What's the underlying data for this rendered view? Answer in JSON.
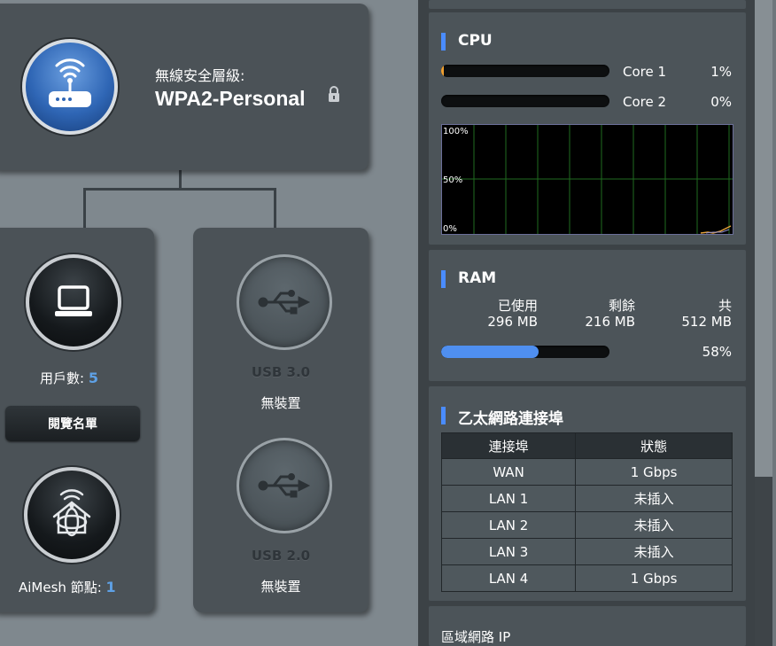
{
  "router": {
    "security_label": "無線安全層級:",
    "security_value": "WPA2-Personal"
  },
  "clients": {
    "label": "用戶數:",
    "count": "5",
    "view_list_label": "閱覽名單"
  },
  "aimesh": {
    "label": "AiMesh 節點:",
    "count": "1"
  },
  "usb": [
    {
      "title": "USB 3.0",
      "status": "無裝置"
    },
    {
      "title": "USB 2.0",
      "status": "無裝置"
    }
  ],
  "cpu": {
    "title": "CPU",
    "cores": [
      {
        "name": "Core 1",
        "usage": "1%",
        "fraction": 0.01
      },
      {
        "name": "Core 2",
        "usage": "0%",
        "fraction": 0.0
      }
    ],
    "graph_labels": [
      "100%",
      "50%",
      "0%"
    ]
  },
  "ram": {
    "title": "RAM",
    "used_label": "已使用",
    "used_value": "296 MB",
    "free_label": "剩餘",
    "free_value": "216 MB",
    "total_label": "共",
    "total_value": "512 MB",
    "percent": "58%",
    "fraction": 0.58
  },
  "ethernet": {
    "title": "乙太網路連接埠",
    "headers": [
      "連接埠",
      "狀態"
    ],
    "rows": [
      [
        "WAN",
        "1 Gbps"
      ],
      [
        "LAN 1",
        "未插入"
      ],
      [
        "LAN 2",
        "未插入"
      ],
      [
        "LAN 3",
        "未插入"
      ],
      [
        "LAN 4",
        "1 Gbps"
      ]
    ]
  },
  "lan_ip": {
    "label": "區域網路 IP"
  },
  "colors": {
    "accent": "#4a8cff",
    "ram_bar": "#4f8ff0",
    "cpu_core1_bar": "#f0a030",
    "count_text": "#5ea1e6",
    "graph_grid": "#1f6b1f",
    "graph_line": "#e5a23a"
  }
}
